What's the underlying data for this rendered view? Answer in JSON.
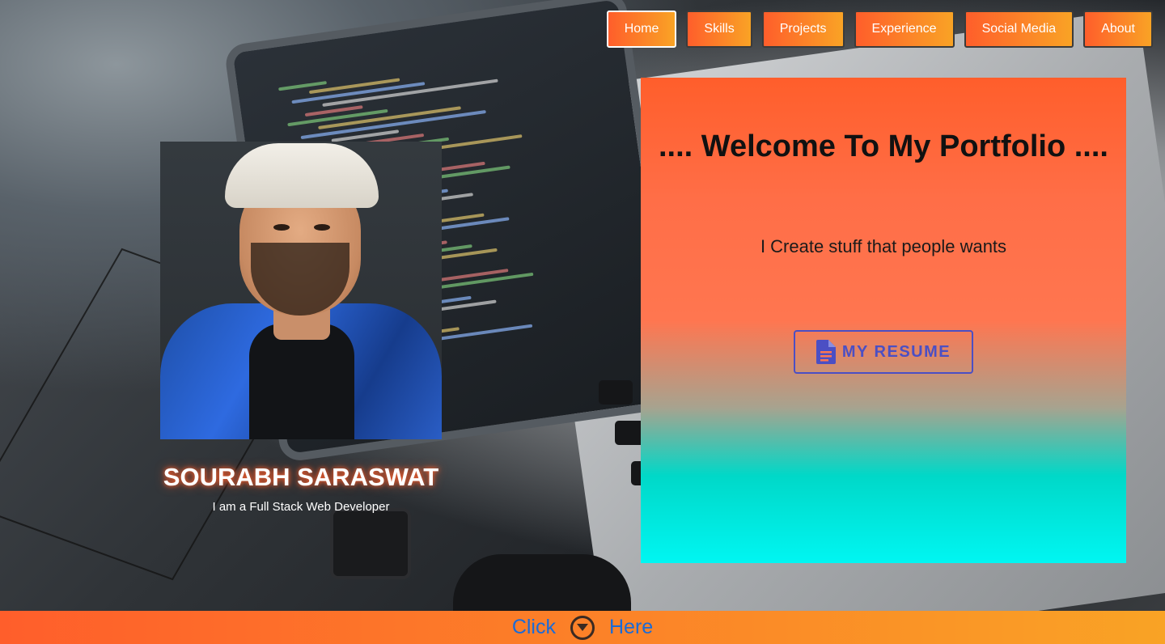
{
  "nav": {
    "items": [
      {
        "label": "Home"
      },
      {
        "label": "Skills"
      },
      {
        "label": "Projects"
      },
      {
        "label": "Experience"
      },
      {
        "label": "Social Media"
      },
      {
        "label": "About"
      }
    ],
    "active": "Home"
  },
  "profile": {
    "name": "SOURABH SARASWAT",
    "tagline": "I am a Full Stack Web Developer"
  },
  "welcome": {
    "title": ".... Welcome To My Portfolio ....",
    "subtitle": "I Create stuff that people wants",
    "resume_label": "MY RESUME",
    "resume_icon": "document-icon"
  },
  "bottom": {
    "left_label": "Click",
    "right_label": "Here",
    "icon": "chevron-down-circle-icon"
  },
  "colors": {
    "accent_orange": "#ff5e2b",
    "accent_yellow": "#f9a325",
    "cyan": "#00f6f2",
    "resume_blue": "#4b4fc4",
    "link_blue": "#1a6bd8"
  }
}
